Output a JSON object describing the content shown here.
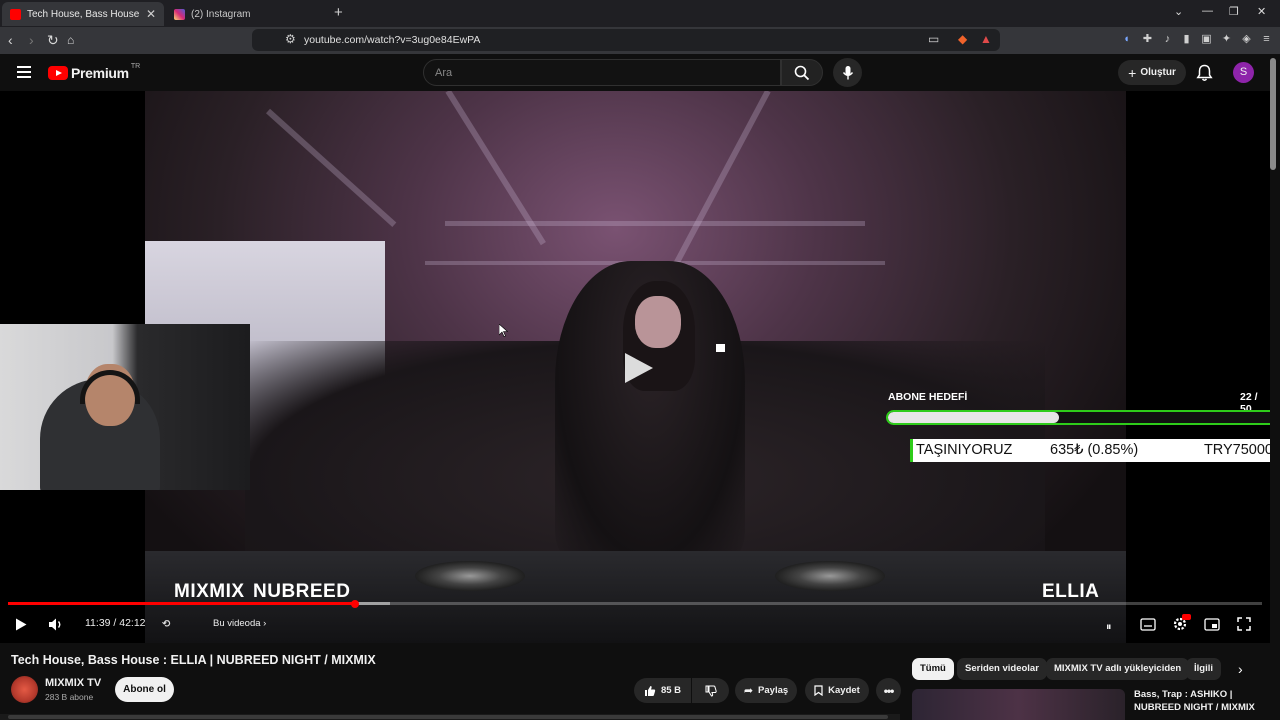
{
  "browser": {
    "tabs": [
      {
        "title": "Tech House, Bass House : ELLIA |",
        "favicon_color": "#ff0000",
        "active": true
      },
      {
        "title": "(2) Instagram",
        "favicon_color": "#d62976",
        "active": false
      }
    ],
    "new_tab": "+",
    "address": "youtube.com/watch?v=3ug0e84EwPA"
  },
  "youtube": {
    "logo_text": "Premium",
    "logo_country": "TR",
    "search_placeholder": "Ara",
    "create_label": "Oluştur",
    "avatar_letter": "S"
  },
  "overlay": {
    "goal_title": "ABONE HEDEFİ",
    "goal_count": "22 / 50",
    "goal_progress": 0.44,
    "ticker": {
      "left": "TAŞINIYORUZ",
      "middle": "635₺ (0.85%)",
      "right": "TRY75000"
    },
    "brand_left": "MIXMIX",
    "brand_mid": "NUBREED",
    "brand_right": "ELLIA"
  },
  "player": {
    "time": "11:39 / 42:12",
    "chapter": "Bu videoda",
    "played_fraction": 0.276,
    "buffered_fraction": 0.305
  },
  "video": {
    "title": "Tech House, Bass House : ELLIA | NUBREED NIGHT / MIXMIX",
    "channel": "MIXMIX TV",
    "subscribers": "283 B abone",
    "subscribe_label": "Abone ol",
    "likes": "85 B",
    "share_label": "Paylaş",
    "save_label": "Kaydet"
  },
  "chips": [
    "Tümü",
    "Seriden videolar",
    "MIXMIX TV adlı yükleyiciden",
    "İlgili"
  ],
  "related": {
    "title": "Bass, Trap : ASHIKO | NUBREED NIGHT / MIXMIX"
  },
  "colors": {
    "accent": "#ff0000",
    "goal_green": "#2ecc1a",
    "avatar": "#8e24aa"
  }
}
